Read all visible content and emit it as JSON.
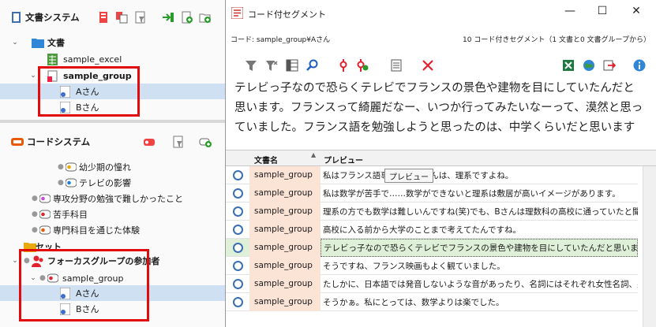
{
  "left": {
    "doc_panel_title": "文書システム",
    "code_panel_title": "コードシステム",
    "doc_tree": [
      {
        "label": "文書",
        "bold": true
      },
      {
        "label": "sample_excel",
        "bold": false
      },
      {
        "label": "sample_group",
        "bold": true
      },
      {
        "label": "Aさん",
        "bold": false
      },
      {
        "label": "Bさん",
        "bold": false
      }
    ],
    "code_tree": [
      {
        "label": "幼少期の憧れ"
      },
      {
        "label": "テレビの影響"
      },
      {
        "label": "専攻分野の勉強で難しかったこと"
      },
      {
        "label": "苦手科目"
      },
      {
        "label": "専門科目を通じた体験"
      },
      {
        "label": "セット"
      },
      {
        "label": "フォーカスグループの参加者"
      },
      {
        "label": "sample_group"
      },
      {
        "label": "Aさん"
      },
      {
        "label": "Bさん"
      }
    ]
  },
  "window": {
    "title": "コード付セグメント",
    "code_path": "コード: sample_group¥Aさん",
    "summary": "10 コード付きセグメント（1 文書と0 文書グループから）",
    "preview_text": "テレビっ子なので恐らくテレビでフランスの景色や建物を目にしていたんだと思います。フランスって綺麗だなー、いつか行ってみたいなーって、漠然と思っていました。フランス語を勉強しようと思ったのは、中学くらいだと思います",
    "grid": {
      "col_doc": "文書名",
      "col_preview": "プレビュー",
      "tooltip": "プレビュー",
      "rows": [
        {
          "doc": "sample_group",
          "preview": "私はフランス語専…………さんは、理系ですよね。",
          "active": false
        },
        {
          "doc": "sample_group",
          "preview": "私は数学が苦手で……数学ができないと理系は敷居が高いイメージがあります。",
          "active": false
        },
        {
          "doc": "sample_group",
          "preview": "理系の方でも数学は難しいんですね(笑)でも、Bさんは理数科の高校に通っていたと聞",
          "active": false
        },
        {
          "doc": "sample_group",
          "preview": "高校に入る前から大学のことまで考えてたんですね。",
          "active": false
        },
        {
          "doc": "sample_group",
          "preview": "テレビっ子なので恐らくテレビでフランスの景色や建物を目にしていたんだと思います。フラ",
          "active": true
        },
        {
          "doc": "sample_group",
          "preview": "そうですね、フランス映画もよく観ていました。",
          "active": false
        },
        {
          "doc": "sample_group",
          "preview": "たしかに、日本語では発音しないような音があったり、名詞にはそれぞれ女性名詞、男性",
          "active": false
        },
        {
          "doc": "sample_group",
          "preview": "そうかぁ。私にとっては、数学よりは楽でした。",
          "active": false
        }
      ]
    }
  }
}
